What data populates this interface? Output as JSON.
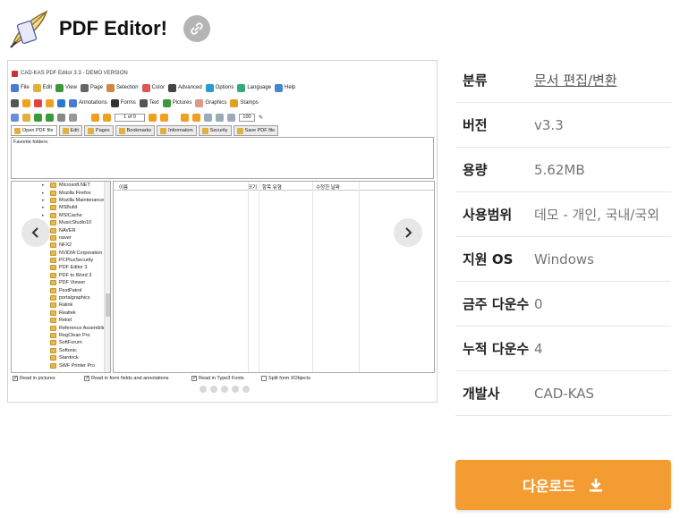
{
  "app": {
    "title": "PDF Editor!",
    "logo_icon": "quill-pen-icon",
    "link_icon": "link-icon"
  },
  "screenshot": {
    "window_title": "CAD-KAS PDF Editor 3.3 - DEMO VERSION",
    "menu": [
      "File",
      "Edit",
      "View",
      "Page",
      "Selection",
      "Color",
      "Advanced",
      "Options",
      "Language",
      "Help"
    ],
    "toolbar2": [
      "Annotations",
      "Forms",
      "Text",
      "Pictures",
      "Graphics",
      "Stamps"
    ],
    "page_field": "1 of 0",
    "zoom_field": "100",
    "tabs": [
      "Open PDF file",
      "Edit",
      "Pages",
      "Bookmarks",
      "Information",
      "Security",
      "Save PDF file"
    ],
    "favorites_label": "Favorite folders:",
    "folders": [
      "Microsoft.NET",
      "Mozilla Firefox",
      "Mozilla Maintenance S",
      "MSBuild",
      "MSICache",
      "MusicStudio10",
      "NAVER",
      "naver",
      "NFX2",
      "NVIDIA Corporation",
      "PCPlusSecurity",
      "PDF Editor 3",
      "PDF to Word 3",
      "PDF Viewer",
      "PestPatrol",
      "portalgraphics",
      "Ralink",
      "Realtek",
      "Reloit",
      "Reference Assemblies",
      "RegClean Pro",
      "SoftForum",
      "Softonic",
      "Stardock",
      "SWF Printer Pro"
    ],
    "file_columns": [
      "이름",
      "크기",
      "항목 유형",
      "수정한 날짜"
    ],
    "checkboxes": [
      "Read in pictures",
      "Read in form fields and annotations",
      "Read in Type3 Fonts",
      "Split form XObjects"
    ],
    "carousel_dots": 5
  },
  "info": {
    "rows": [
      {
        "label": "분류",
        "value": "문서 편집/변환"
      },
      {
        "label": "버전",
        "value": "v3.3"
      },
      {
        "label": "용량",
        "value": "5.62MB"
      },
      {
        "label": "사용범위",
        "value": "데모 - 개인, 국내/국외"
      },
      {
        "label": "지원 OS",
        "value": "Windows"
      },
      {
        "label": "금주 다운수",
        "value": "0"
      },
      {
        "label": "누적 다운수",
        "value": "4"
      },
      {
        "label": "개발사",
        "value": "CAD-KAS"
      }
    ]
  },
  "download": {
    "label": "다운로드",
    "icon": "download-icon",
    "color": "#f39c32"
  }
}
